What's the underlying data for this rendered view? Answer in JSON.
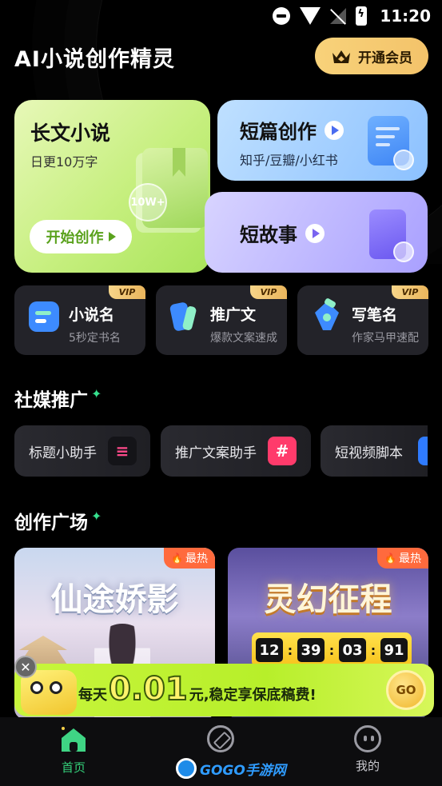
{
  "status_bar": {
    "time": "11:20"
  },
  "header": {
    "app_title": "AI小说创作精灵",
    "vip_label": "开通会员"
  },
  "hero": {
    "long_novel": {
      "title": "长文小说",
      "subtitle": "日更10万字",
      "badge": "10W+",
      "start_label": "开始创作"
    },
    "short_piece": {
      "title": "短篇创作",
      "subtitle": "知乎/豆瓣/小红书"
    },
    "short_story": {
      "title": "短故事"
    }
  },
  "tools": [
    {
      "title": "小说名",
      "subtitle": "5秒定书名",
      "tag": "VIP"
    },
    {
      "title": "推广文",
      "subtitle": "爆款文案速成",
      "tag": "VIP"
    },
    {
      "title": "写笔名",
      "subtitle": "作家马甲速配",
      "tag": "VIP"
    }
  ],
  "social": {
    "section_title": "社媒推广",
    "chips": [
      {
        "label": "标题小助手",
        "icon": "title-tool-icon"
      },
      {
        "label": "推广文案助手",
        "icon": "hashtag-icon"
      },
      {
        "label": "短视频脚本",
        "icon": "video-script-icon"
      }
    ]
  },
  "plaza": {
    "section_title": "创作广场",
    "cards": [
      {
        "title": "仙途娇影",
        "tag": "最热"
      },
      {
        "title": "灵幻征程",
        "tag": "最热",
        "countdown": [
          "12",
          "39",
          "03",
          "91"
        ]
      }
    ]
  },
  "promo": {
    "prefix": "每天",
    "amount": "0.01",
    "suffix": "元,稳定享保底稿费!",
    "go_label": "GO"
  },
  "nav": {
    "items": [
      {
        "label": "首页",
        "icon": "home-icon",
        "active": true
      },
      {
        "label": "",
        "icon": "compass-icon",
        "active": false
      },
      {
        "label": "我的",
        "icon": "face-icon",
        "active": false
      }
    ]
  },
  "watermark": {
    "text": "GOGO手游网"
  },
  "colors": {
    "accent_green": "#34d07a",
    "vip_gold": "#f3c36a",
    "hot_orange": "#ff6a3d"
  }
}
